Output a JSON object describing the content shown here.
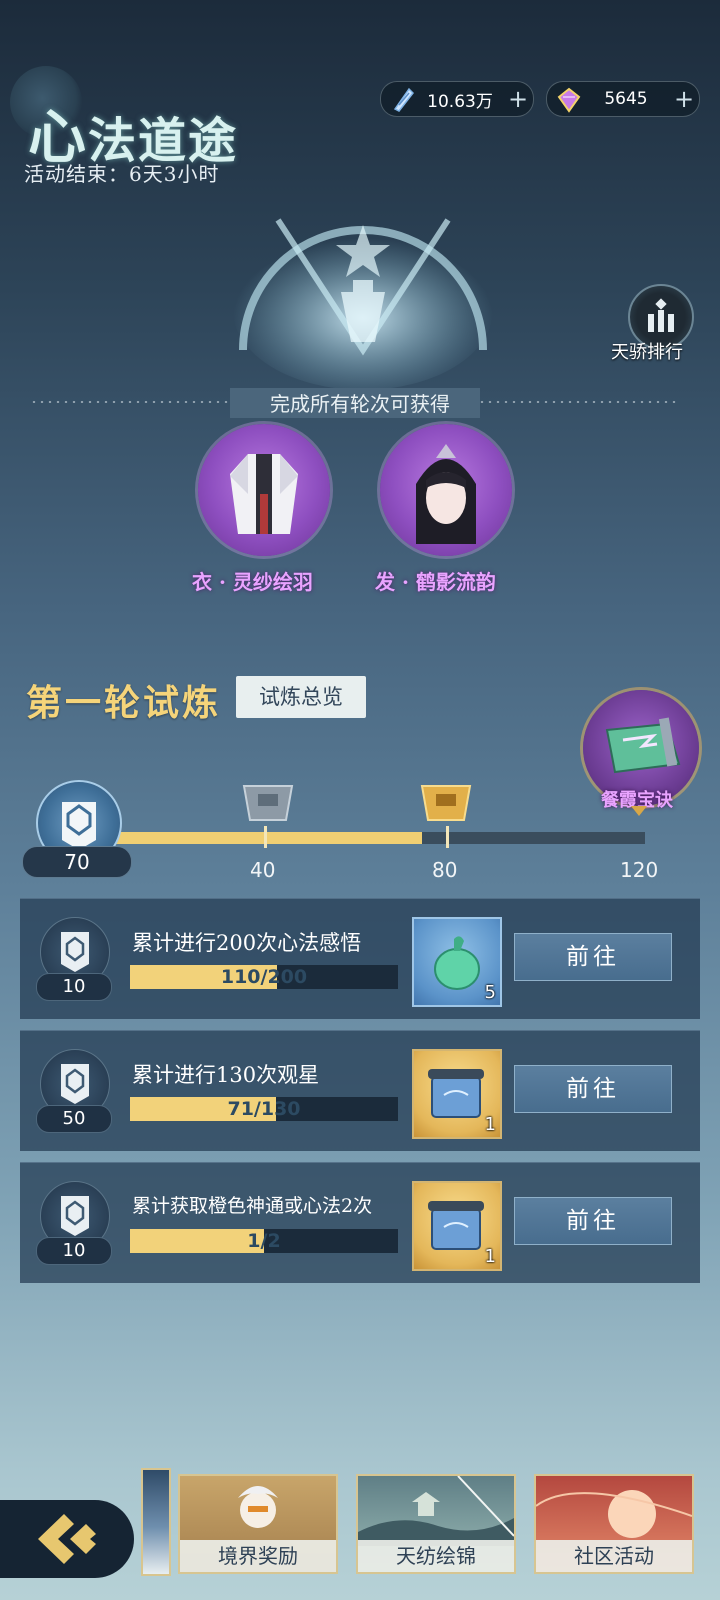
{
  "header": {
    "title_first": "心",
    "title_rest": "法道途",
    "subtitle": "活动结束：6天3小时"
  },
  "currencies": [
    {
      "icon": "feather-crystal-icon",
      "value": "10.63万",
      "plus": "+"
    },
    {
      "icon": "purple-gem-icon",
      "value": "5645",
      "plus": "+"
    }
  ],
  "ranking": {
    "label": "天骄排行",
    "icon": "ranking-tower-icon"
  },
  "rewards": {
    "caption": "完成所有轮次可获得",
    "items": [
      {
        "name": "衣 · 灵纱绘羽",
        "icon": "robe-outfit-icon"
      },
      {
        "name": "发 · 鹤影流韵",
        "icon": "hairstyle-portrait-icon"
      }
    ]
  },
  "round": {
    "title": "第一轮试炼",
    "overview_button": "试炼总览",
    "current_score": "70",
    "progress_fraction": 0.583,
    "milestones": [
      {
        "value": "40",
        "icon": "silver-chest-icon"
      },
      {
        "value": "80",
        "icon": "gold-chest-icon"
      },
      {
        "value": "120",
        "name": "餐霞宝诀",
        "icon": "scroll-treasure-icon"
      }
    ]
  },
  "tasks": [
    {
      "points": "10",
      "desc": "累计进行200次心法感悟",
      "progress_text": "110/200",
      "progress_fraction": 0.55,
      "item_icon": "jade-gourd-icon",
      "item_count": "5",
      "item_quality": "blue",
      "button": "前往"
    },
    {
      "points": "50",
      "desc": "累计进行130次观星",
      "progress_text": "71/130",
      "progress_fraction": 0.546,
      "item_icon": "scroll-item-icon",
      "item_count": "1",
      "item_quality": "gold",
      "button": "前往"
    },
    {
      "points": "10",
      "desc": "累计获取橙色神通或心法2次",
      "progress_text": "1/2",
      "progress_fraction": 0.5,
      "item_icon": "scroll-item-icon",
      "item_count": "1",
      "item_quality": "gold",
      "button": "前往"
    }
  ],
  "bottom_nav": [
    {
      "label": "境界奖励",
      "icon": "character-portrait-icon"
    },
    {
      "label": "天纺绘锦",
      "icon": "weaving-landscape-icon"
    },
    {
      "label": "社区活动",
      "icon": "sunset-landscape-icon"
    }
  ],
  "colors": {
    "gold": "#f0cf73",
    "purple_reward": "#e9a3ff",
    "mint_title": "#d8f1ef"
  }
}
